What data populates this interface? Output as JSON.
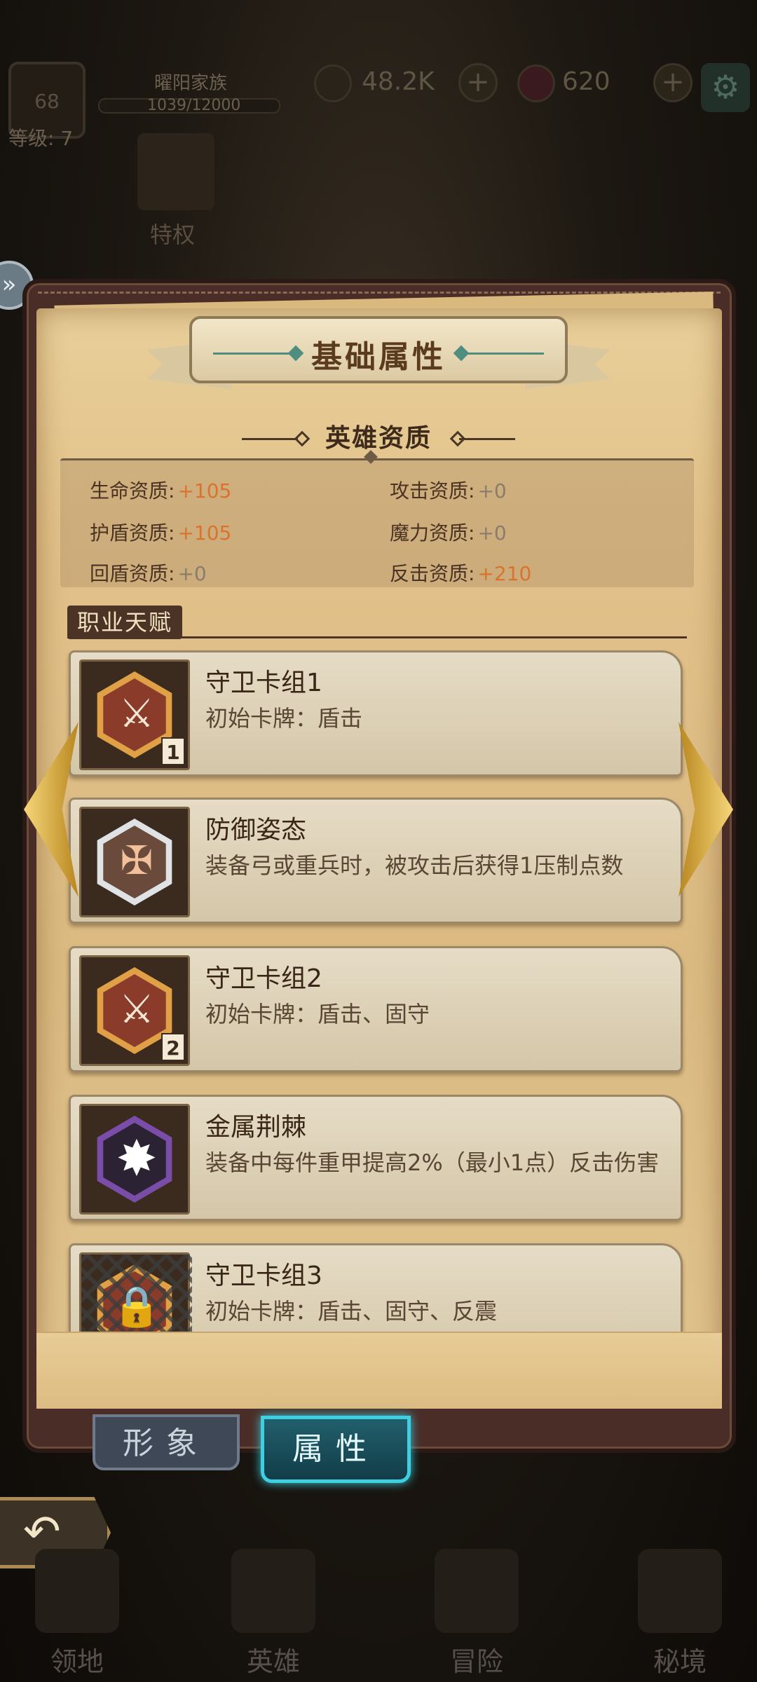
{
  "topbar": {
    "guild_name": "曜阳家族",
    "exp_text": "1039/12000",
    "level_text": "等级: 7",
    "gold": "48.2K",
    "gems": "620",
    "privilege_label": "特权"
  },
  "panel": {
    "title": "基础属性",
    "hero_aptitude_title": "英雄资质",
    "aptitudes": [
      {
        "label": "生命资质:",
        "value": "+105"
      },
      {
        "label": "攻击资质:",
        "value": "+0"
      },
      {
        "label": "护盾资质:",
        "value": "+105"
      },
      {
        "label": "魔力资质:",
        "value": "+0"
      },
      {
        "label": "回盾资质:",
        "value": "+0"
      },
      {
        "label": "反击资质:",
        "value": "+210"
      }
    ],
    "talent_section_title": "职业天赋",
    "talents": [
      {
        "name": "守卫卡组1",
        "desc": "初始卡牌：盾击",
        "badge": "1",
        "icon": "axe-crest-icon"
      },
      {
        "name": "防御姿态",
        "desc": "装备弓或重兵时，被攻击后获得1压制点数",
        "badge": "",
        "icon": "crossbow-crest-icon"
      },
      {
        "name": "守卫卡组2",
        "desc": "初始卡牌：盾击、固守",
        "badge": "2",
        "icon": "axe-crest-icon"
      },
      {
        "name": "金属荆棘",
        "desc": "装备中每件重甲提高2%（最小1点）反击伤害",
        "badge": "",
        "icon": "spiked-star-icon"
      },
      {
        "name": "守卫卡组3",
        "desc": "初始卡牌：盾击、固守、反震",
        "badge": "",
        "icon": "locked-chain-icon"
      }
    ]
  },
  "tabs": {
    "look": "形象",
    "attributes": "属性"
  },
  "bottom_nav": [
    "领地",
    "英雄",
    "冒险",
    "秘境"
  ],
  "colors": {
    "positive_value": "#d9732e",
    "zero_value": "#8a7d6d",
    "active_tab_glow": "#3ed0e0"
  }
}
